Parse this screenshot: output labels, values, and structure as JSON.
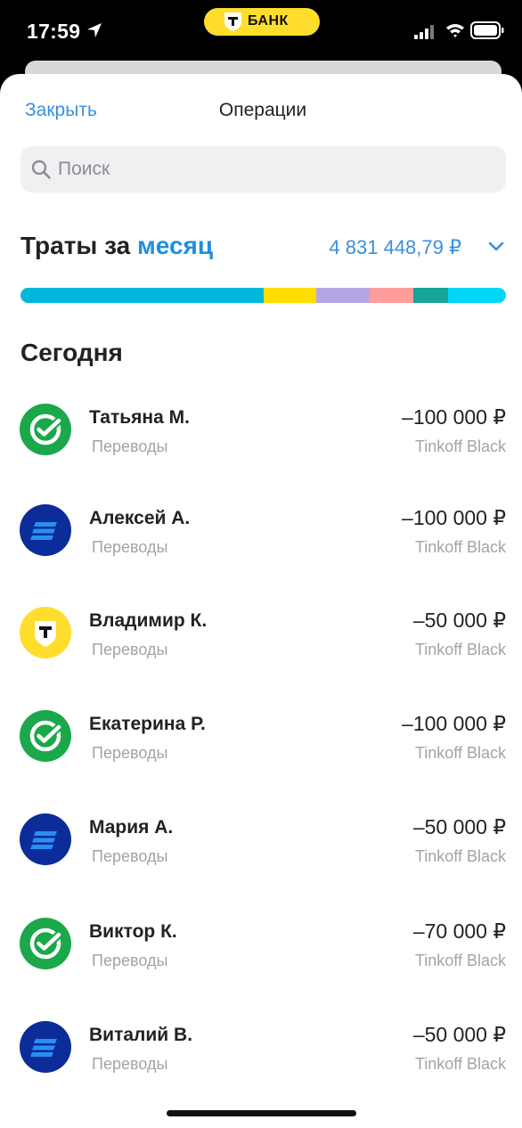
{
  "status_bar": {
    "time": "17:59",
    "location_icon": "location-arrow-icon",
    "bank_pill_text": "БАНК",
    "bank_pill_color": "#ffdd2d",
    "signal_icon": "cellular-signal-icon",
    "wifi_icon": "wifi-icon",
    "battery_icon": "battery-icon"
  },
  "header": {
    "close_label": "Закрыть",
    "title": "Операции"
  },
  "search": {
    "placeholder": "Поиск",
    "value": ""
  },
  "spending": {
    "label": "Траты за",
    "period": "месяц",
    "total": "4 831 448,79 ₽",
    "segments": [
      {
        "color": "#00b8dc",
        "share": 0.5
      },
      {
        "color": "#ffdd00",
        "share": 0.11
      },
      {
        "color": "#b5a6e6",
        "share": 0.11
      },
      {
        "color": "#ff9c9c",
        "share": 0.09
      },
      {
        "color": "#16a597",
        "share": 0.07
      },
      {
        "color": "#00d7f5",
        "share": 0.12
      }
    ]
  },
  "section": {
    "title": "Сегодня"
  },
  "operations": [
    {
      "name": "Татьяна М.",
      "category": "Переводы",
      "amount": "–100 000 ₽",
      "account": "Tinkoff Black",
      "bank_icon": "sber-logo-icon"
    },
    {
      "name": "Алексей А.",
      "category": "Переводы",
      "amount": "–100 000 ₽",
      "account": "Tinkoff Black",
      "bank_icon": "vtb-logo-icon"
    },
    {
      "name": "Владимир К.",
      "category": "Переводы",
      "amount": "–50 000 ₽",
      "account": "Tinkoff Black",
      "bank_icon": "tbank-logo-icon"
    },
    {
      "name": "Екатерина Р.",
      "category": "Переводы",
      "amount": "–100 000 ₽",
      "account": "Tinkoff Black",
      "bank_icon": "sber-logo-icon"
    },
    {
      "name": "Мария А.",
      "category": "Переводы",
      "amount": "–50 000 ₽",
      "account": "Tinkoff Black",
      "bank_icon": "vtb-logo-icon"
    },
    {
      "name": "Виктор К.",
      "category": "Переводы",
      "amount": "–70 000 ₽",
      "account": "Tinkoff Black",
      "bank_icon": "sber-logo-icon"
    },
    {
      "name": "Виталий В.",
      "category": "Переводы",
      "amount": "–50 000 ₽",
      "account": "Tinkoff Black",
      "bank_icon": "vtb-logo-icon"
    }
  ]
}
